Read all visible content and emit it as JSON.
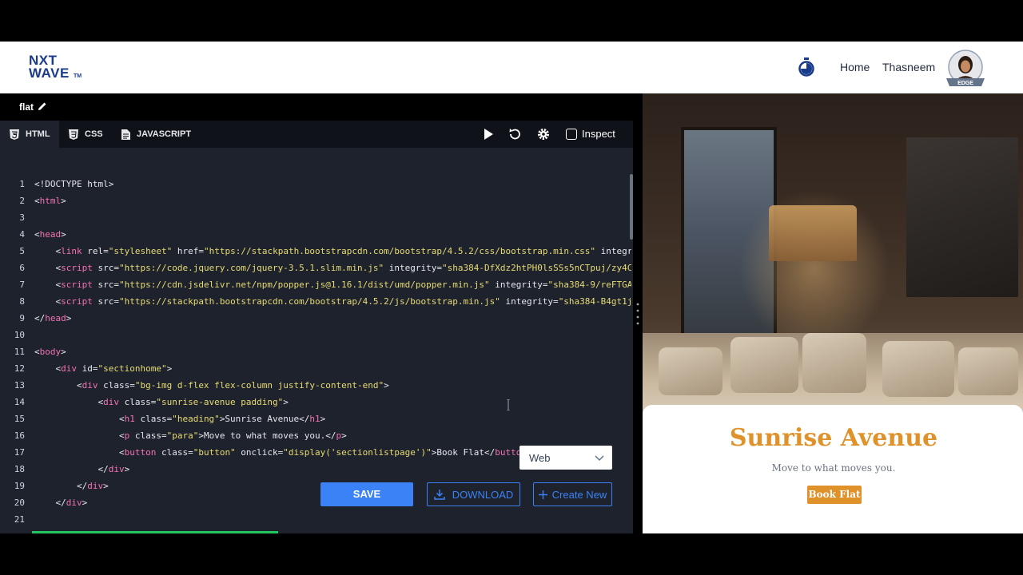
{
  "logo": {
    "line1": "NXT",
    "line2": "WAVE",
    "tm": "TM"
  },
  "nav": {
    "home": "Home",
    "user": "Thasneem",
    "avatar_badge": "EDGE"
  },
  "editor": {
    "filename": "flat",
    "tabs": [
      {
        "label": "HTML",
        "icon": "html5-icon"
      },
      {
        "label": "CSS",
        "icon": "css3-icon"
      },
      {
        "label": "JAVASCRIPT",
        "icon": "js-file-icon"
      }
    ],
    "inspect_label": "Inspect",
    "lines": [
      {
        "n": "1",
        "parts": [
          [
            "p",
            "<!DOCTYPE html>"
          ]
        ]
      },
      {
        "n": "2",
        "parts": [
          [
            "p",
            "<"
          ],
          [
            "t",
            "html"
          ],
          [
            "p",
            ">"
          ]
        ]
      },
      {
        "n": "3",
        "parts": []
      },
      {
        "n": "4",
        "parts": [
          [
            "p",
            "<"
          ],
          [
            "t",
            "head"
          ],
          [
            "p",
            ">"
          ]
        ]
      },
      {
        "n": "5",
        "parts": [
          [
            "p",
            "    <"
          ],
          [
            "t",
            "link"
          ],
          [
            "p",
            " rel="
          ],
          [
            "s",
            "\"stylesheet\""
          ],
          [
            "p",
            " href="
          ],
          [
            "s",
            "\"https://stackpath.bootstrapcdn.com/bootstrap/4.5.2/css/bootstrap.min.css\""
          ],
          [
            "p",
            " integr"
          ]
        ]
      },
      {
        "n": "6",
        "parts": [
          [
            "p",
            "    <"
          ],
          [
            "t",
            "script"
          ],
          [
            "p",
            " src="
          ],
          [
            "s",
            "\"https://code.jquery.com/jquery-3.5.1.slim.min.js\""
          ],
          [
            "p",
            " integrity="
          ],
          [
            "s",
            "\"sha384-DfXdz2htPH0lsSSs5nCTpuj/zy4C"
          ]
        ]
      },
      {
        "n": "7",
        "parts": [
          [
            "p",
            "    <"
          ],
          [
            "t",
            "script"
          ],
          [
            "p",
            " src="
          ],
          [
            "s",
            "\"https://cdn.jsdelivr.net/npm/popper.js@1.16.1/dist/umd/popper.min.js\""
          ],
          [
            "p",
            " integrity="
          ],
          [
            "s",
            "\"sha384-9/reFTGA"
          ]
        ]
      },
      {
        "n": "8",
        "parts": [
          [
            "p",
            "    <"
          ],
          [
            "t",
            "script"
          ],
          [
            "p",
            " src="
          ],
          [
            "s",
            "\"https://stackpath.bootstrapcdn.com/bootstrap/4.5.2/js/bootstrap.min.js\""
          ],
          [
            "p",
            " integrity="
          ],
          [
            "s",
            "\"sha384-B4gt1j"
          ]
        ]
      },
      {
        "n": "9",
        "parts": [
          [
            "p",
            "</"
          ],
          [
            "t",
            "head"
          ],
          [
            "p",
            ">"
          ]
        ]
      },
      {
        "n": "10",
        "parts": []
      },
      {
        "n": "11",
        "parts": [
          [
            "p",
            "<"
          ],
          [
            "t",
            "body"
          ],
          [
            "p",
            ">"
          ]
        ]
      },
      {
        "n": "12",
        "parts": [
          [
            "p",
            "    <"
          ],
          [
            "t",
            "div"
          ],
          [
            "p",
            " id="
          ],
          [
            "s",
            "\"sectionhome\""
          ],
          [
            "p",
            ">"
          ]
        ]
      },
      {
        "n": "13",
        "parts": [
          [
            "p",
            "        <"
          ],
          [
            "t",
            "div"
          ],
          [
            "p",
            " class="
          ],
          [
            "s",
            "\"bg-img d-flex flex-column justify-content-end\""
          ],
          [
            "p",
            ">"
          ]
        ]
      },
      {
        "n": "14",
        "parts": [
          [
            "p",
            "            <"
          ],
          [
            "t",
            "div"
          ],
          [
            "p",
            " class="
          ],
          [
            "s",
            "\"sunrise-avenue padding\""
          ],
          [
            "p",
            ">"
          ]
        ]
      },
      {
        "n": "15",
        "parts": [
          [
            "p",
            "                <"
          ],
          [
            "t",
            "h1"
          ],
          [
            "p",
            " class="
          ],
          [
            "s",
            "\"heading\""
          ],
          [
            "p",
            ">Sunrise Avenue</"
          ],
          [
            "t",
            "h1"
          ],
          [
            "p",
            ">"
          ]
        ]
      },
      {
        "n": "16",
        "parts": [
          [
            "p",
            "                <"
          ],
          [
            "t",
            "p"
          ],
          [
            "p",
            " class="
          ],
          [
            "s",
            "\"para\""
          ],
          [
            "p",
            ">Move to what moves you.</"
          ],
          [
            "t",
            "p"
          ],
          [
            "p",
            ">"
          ]
        ]
      },
      {
        "n": "17",
        "parts": [
          [
            "p",
            "                <"
          ],
          [
            "t",
            "button"
          ],
          [
            "p",
            " class="
          ],
          [
            "s",
            "\"button\""
          ],
          [
            "p",
            " onclick="
          ],
          [
            "s",
            "\"display('sectionlistpage')\""
          ],
          [
            "p",
            ">Book Flat</"
          ],
          [
            "t",
            "button"
          ]
        ]
      },
      {
        "n": "18",
        "parts": [
          [
            "p",
            "            </"
          ],
          [
            "t",
            "div"
          ],
          [
            "p",
            ">"
          ]
        ]
      },
      {
        "n": "19",
        "parts": [
          [
            "p",
            "        </"
          ],
          [
            "t",
            "div"
          ],
          [
            "p",
            ">"
          ]
        ]
      },
      {
        "n": "20",
        "parts": [
          [
            "p",
            "    </"
          ],
          [
            "t",
            "div"
          ],
          [
            "p",
            ">"
          ]
        ]
      },
      {
        "n": "21",
        "parts": []
      }
    ]
  },
  "actions": {
    "select_value": "Web",
    "save": "SAVE",
    "download": "DOWNLOAD",
    "create_new": "Create New"
  },
  "preview": {
    "heading": "Sunrise Avenue",
    "para": "Move to what moves you.",
    "button": "Book Flat"
  },
  "colors": {
    "accent": "#3b82f6",
    "brand_orange": "#e0922a",
    "editor_bg": "#1e222c",
    "tag": "#f472b6",
    "string": "#e6db74"
  }
}
